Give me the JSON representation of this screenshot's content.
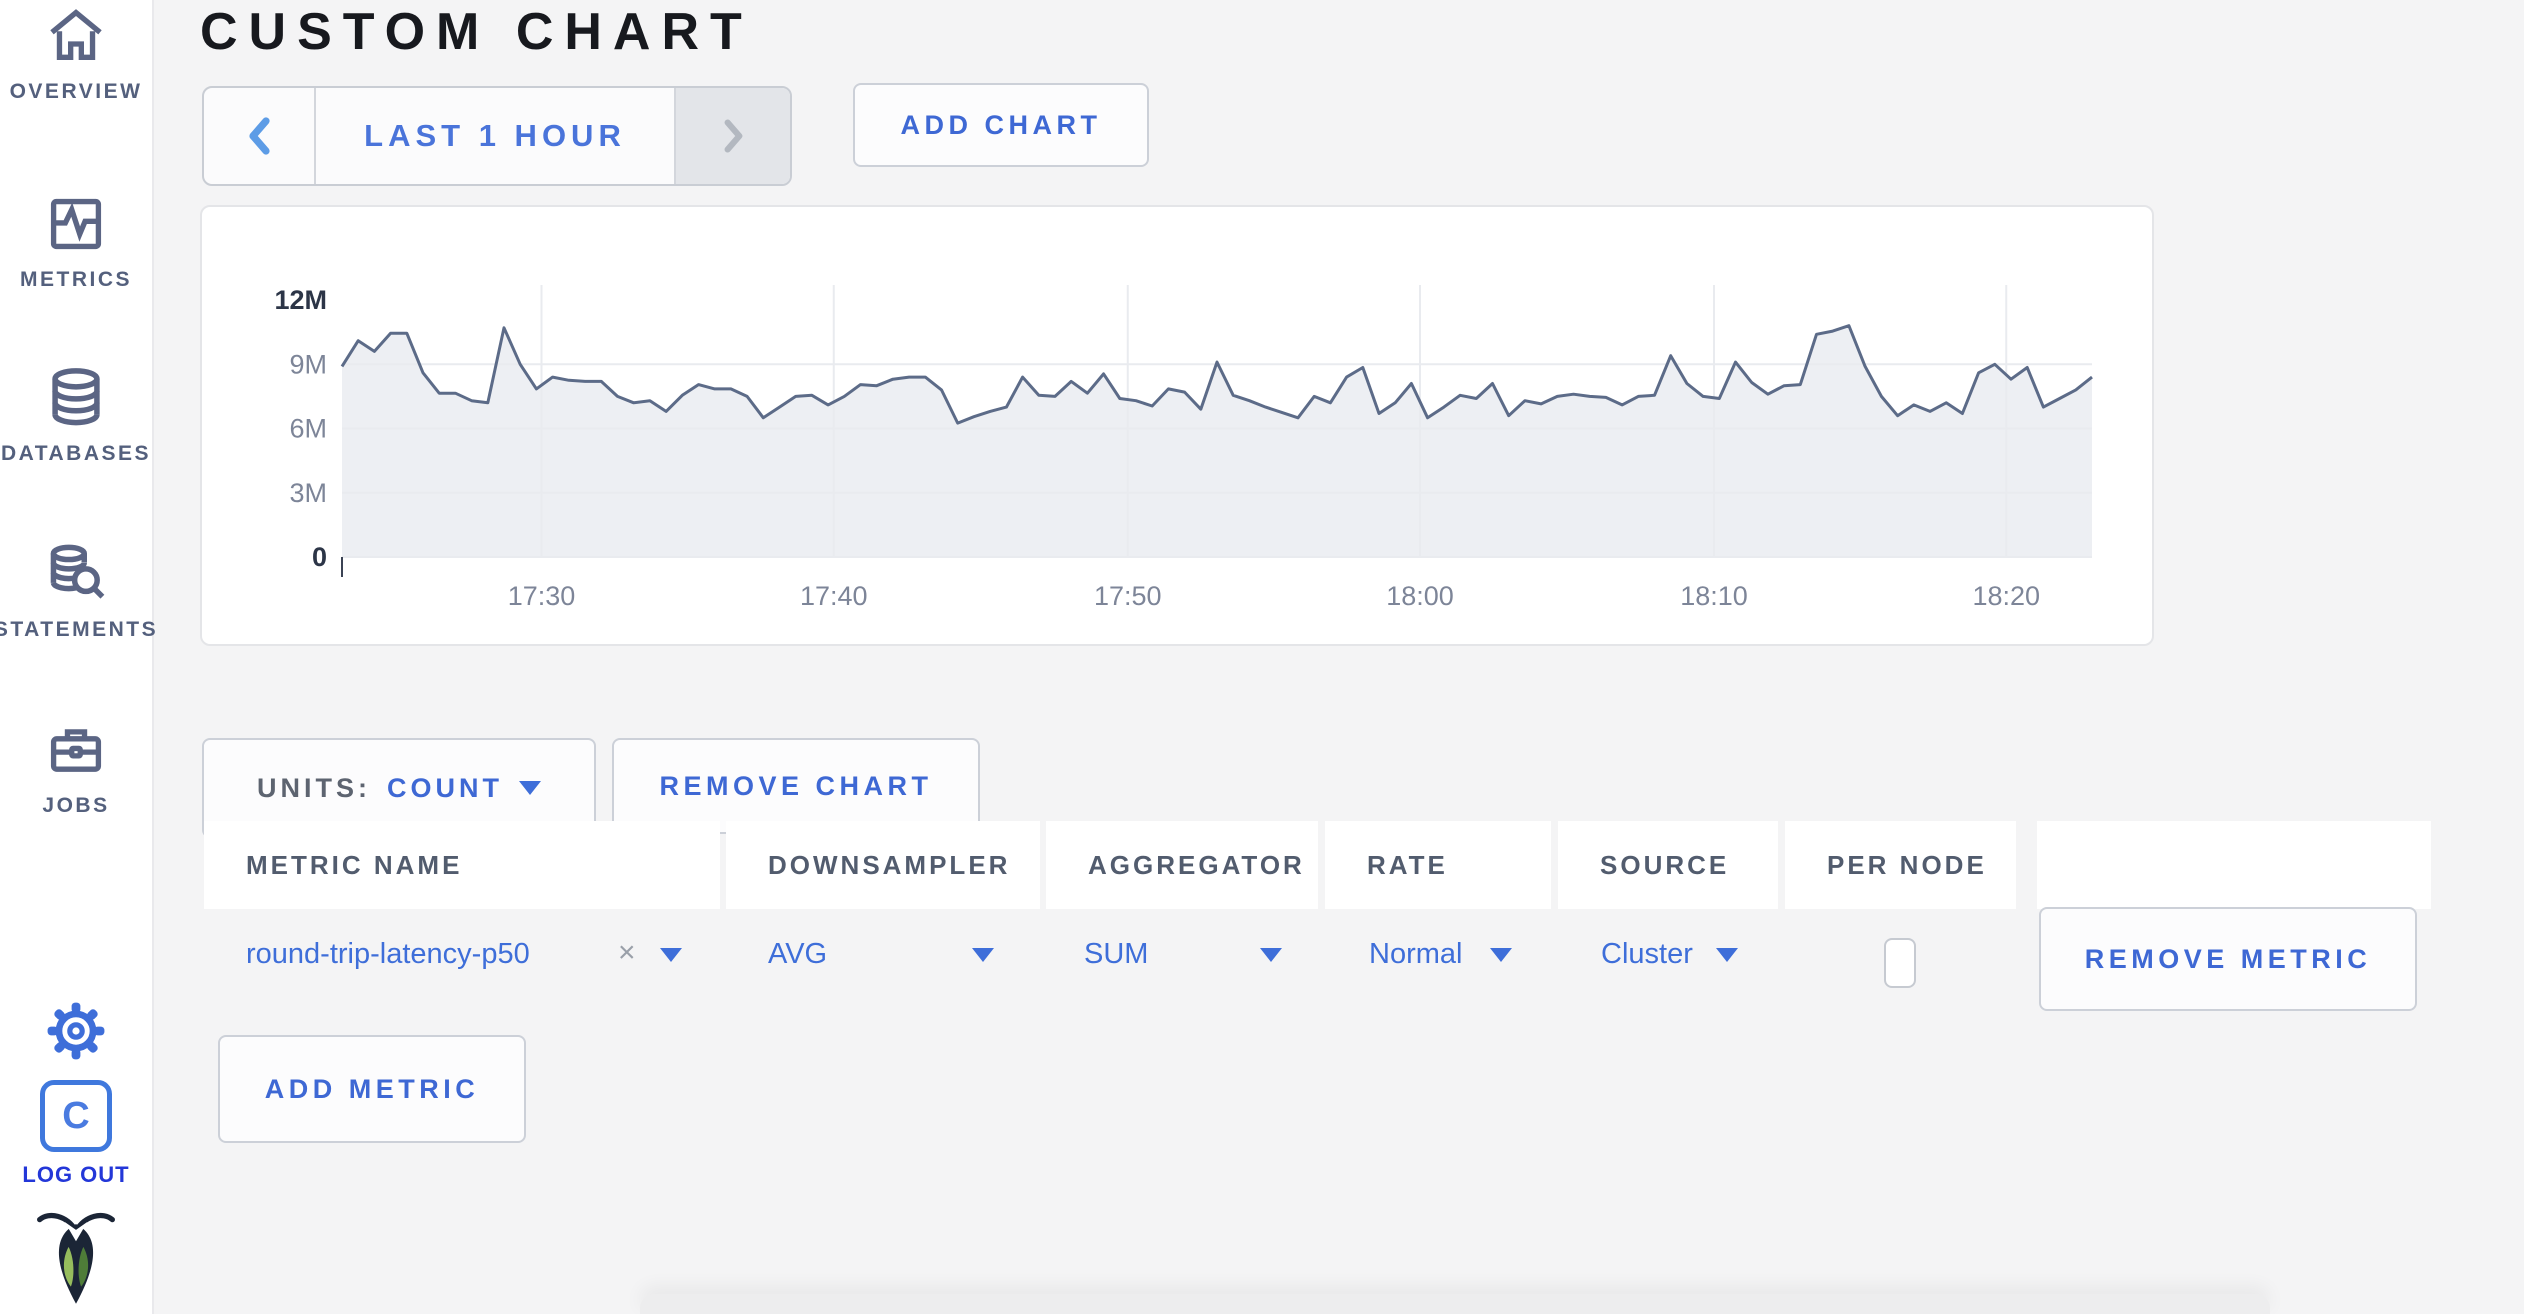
{
  "sidebar": {
    "items": [
      {
        "label": "OVERVIEW",
        "icon": "home-icon"
      },
      {
        "label": "METRICS",
        "icon": "metrics-icon"
      },
      {
        "label": "DATABASES",
        "icon": "databases-icon"
      },
      {
        "label": "STATEMENTS",
        "icon": "statements-icon"
      },
      {
        "label": "JOBS",
        "icon": "jobs-icon"
      }
    ],
    "settings_icon": "gear-icon",
    "logout": {
      "label": "LOG OUT",
      "icon": "cockroach-c-logo"
    },
    "brand_icon": "cockroach-bug-logo"
  },
  "header": {
    "title": "CUSTOM CHART"
  },
  "time_selector": {
    "label": "LAST 1 HOUR",
    "prev_icon": "chevron-left-icon",
    "next_icon": "chevron-right-icon"
  },
  "buttons": {
    "add_chart": "ADD CHART",
    "remove_chart": "REMOVE CHART",
    "remove_metric": "REMOVE METRIC",
    "add_metric": "ADD METRIC"
  },
  "units": {
    "label": "UNITS:",
    "value": "COUNT"
  },
  "table": {
    "headers": [
      "METRIC NAME",
      "DOWNSAMPLER",
      "AGGREGATOR",
      "RATE",
      "SOURCE",
      "PER NODE"
    ],
    "row": {
      "metric_name": "round-trip-latency-p50",
      "clear_glyph": "×",
      "downsampler": "AVG",
      "aggregator": "SUM",
      "rate": "Normal",
      "source": "Cluster",
      "per_node_checked": false
    }
  },
  "colors": {
    "accent_blue": "#3e6ed9",
    "logout_blue": "#2337d8",
    "sidebar_slate": "#5b6584",
    "line": "#5c6b88",
    "fill": "#edeff3",
    "grid": "#e9ebef",
    "tick_dark": "#2c3547",
    "tick_gray": "#7d8598"
  },
  "chart_data": {
    "type": "area",
    "title": "",
    "xlabel": "",
    "ylabel": "count",
    "grid": true,
    "legend": "none",
    "ylim_millions": [
      0,
      12
    ],
    "y_ticks": [
      "0",
      "3M",
      "6M",
      "9M",
      "12M"
    ],
    "y_tick_values_millions": [
      0,
      3,
      6,
      9,
      12
    ],
    "x_ticks": [
      "17:30",
      "17:40",
      "17:50",
      "18:00",
      "18:10",
      "18:20"
    ],
    "x_tick_fractions": [
      0.114,
      0.281,
      0.449,
      0.616,
      0.784,
      0.951
    ],
    "x_range": [
      "17:23",
      "18:23"
    ],
    "series": [
      {
        "name": "round-trip-latency-p50",
        "values_millions": [
          8.9,
          10.1,
          9.6,
          10.45,
          10.45,
          8.6,
          7.65,
          7.65,
          7.3,
          7.2,
          10.7,
          9.0,
          7.85,
          8.4,
          8.25,
          8.2,
          8.2,
          7.5,
          7.2,
          7.3,
          6.8,
          7.55,
          8.05,
          7.85,
          7.85,
          7.5,
          6.5,
          7.0,
          7.5,
          7.55,
          7.1,
          7.5,
          8.05,
          8.0,
          8.3,
          8.4,
          8.4,
          7.8,
          6.25,
          6.55,
          6.8,
          7.0,
          8.4,
          7.55,
          7.5,
          8.2,
          7.65,
          8.55,
          7.4,
          7.3,
          7.05,
          7.85,
          7.7,
          6.9,
          9.1,
          7.55,
          7.3,
          7.0,
          6.75,
          6.5,
          7.5,
          7.2,
          8.4,
          8.85,
          6.7,
          7.2,
          8.1,
          6.5,
          7.0,
          7.55,
          7.4,
          8.1,
          6.6,
          7.3,
          7.15,
          7.5,
          7.6,
          7.5,
          7.45,
          7.1,
          7.5,
          7.55,
          9.4,
          8.1,
          7.5,
          7.4,
          9.1,
          8.15,
          7.6,
          8.0,
          8.05,
          10.4,
          10.55,
          10.8,
          8.9,
          7.5,
          6.6,
          7.1,
          6.8,
          7.2,
          6.7,
          8.6,
          9.0,
          8.3,
          8.85,
          7.0,
          7.4,
          7.8,
          8.4
        ]
      }
    ]
  }
}
